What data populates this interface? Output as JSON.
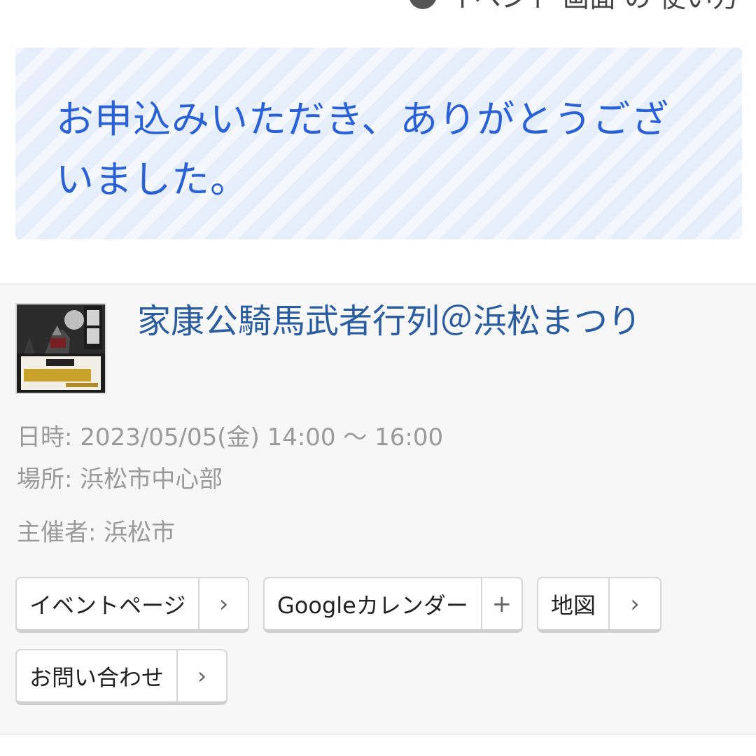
{
  "header": {
    "cut_text": "イベント 画面 の 使い方"
  },
  "banner": {
    "message": "お申込みいただき、ありがとうございました。"
  },
  "event": {
    "thumbnail_text": "家康公騎馬武者行列@浜松まつり",
    "title": "家康公騎馬武者行列＠浜松まつり",
    "date": "日時: 2023/05/05(金) 14:00 〜 16:00",
    "place": "場所: 浜松市中心部",
    "organizer": "主催者: 浜松市",
    "buttons": [
      {
        "label": "イベントページ",
        "icon": "chevron-right-icon",
        "symbol": "›"
      },
      {
        "label": "Googleカレンダー",
        "icon": "plus-icon",
        "symbol": "+"
      },
      {
        "label": "地図",
        "icon": "chevron-right-icon",
        "symbol": "›"
      },
      {
        "label": "お問い合わせ",
        "icon": "chevron-right-icon",
        "symbol": "›"
      }
    ]
  },
  "colors": {
    "banner_text": "#2a62d6",
    "banner_bg": "#e6edfb",
    "title": "#2a5d9f",
    "info_text": "#9a9a9a"
  }
}
